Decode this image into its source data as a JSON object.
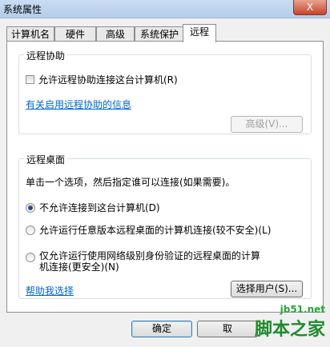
{
  "window": {
    "title": "系统属性",
    "close_label": "X"
  },
  "tabs": [
    {
      "label": "计算机名"
    },
    {
      "label": "硬件"
    },
    {
      "label": "高级"
    },
    {
      "label": "系统保护"
    },
    {
      "label": "远程",
      "active": true
    }
  ],
  "remote_assistance": {
    "legend": "远程协助",
    "checkbox_label": "允许远程协助连接这台计算机(R)",
    "checkbox_checked": false,
    "info_link": "有关启用远程协助的信息",
    "advanced_button": "高级(V)..."
  },
  "remote_desktop": {
    "legend": "远程桌面",
    "instruction": "单击一个选项，然后指定谁可以连接(如果需要)。",
    "options": [
      {
        "label": "不允许连接到这台计算机(D)",
        "checked": true
      },
      {
        "label": "允许运行任意版本远程桌面的计算机连接(较不安全)(L)",
        "checked": false
      },
      {
        "label_line1": "仅允许运行使用网络级别身份验证的远程桌面的计算",
        "label_line2": "机连接(更安全)(N)",
        "checked": false
      }
    ],
    "help_link": "帮助我选择",
    "select_users_button": "选择用户(S)..."
  },
  "footer": {
    "ok_button": "确定",
    "cancel_button_partial": "取"
  },
  "watermark": {
    "url": "jb51.net",
    "text": "脚本之家"
  }
}
